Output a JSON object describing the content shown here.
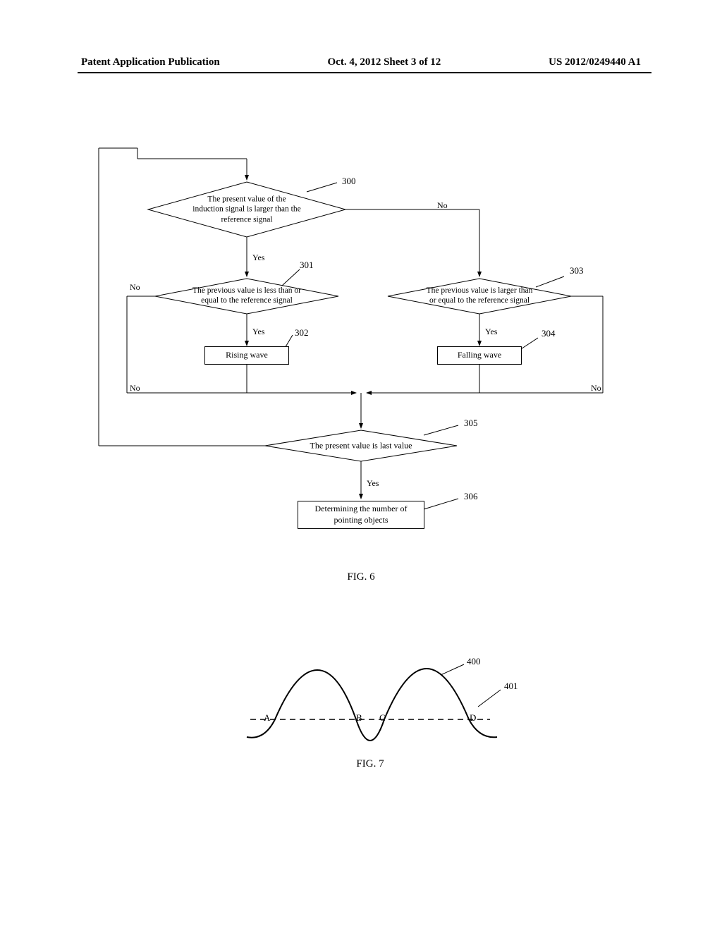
{
  "header": {
    "left": "Patent Application Publication",
    "center": "Oct. 4, 2012   Sheet 3 of 12",
    "right": "US 2012/0249440 A1"
  },
  "flowchart": {
    "decision_300": "The present value of the\ninduction signal is larger than the\nreference signal",
    "decision_301": "The previous value is less than or\nequal to the reference signal",
    "decision_303": "The previous value is larger than\nor equal to the reference signal",
    "decision_305": "The present value is last value",
    "process_302": "Rising wave",
    "process_304": "Falling wave",
    "process_306": "Determining the number of\npointing objects",
    "label_yes": "Yes",
    "label_no": "No",
    "ref_300": "300",
    "ref_301": "301",
    "ref_302": "302",
    "ref_303": "303",
    "ref_304": "304",
    "ref_305": "305",
    "ref_306": "306"
  },
  "fig6_caption": "FIG. 6",
  "fig7": {
    "ref_400": "400",
    "ref_401": "401",
    "label_A": "A",
    "label_B": "B",
    "label_C": "C",
    "label_D": "D"
  },
  "fig7_caption": "FIG. 7"
}
